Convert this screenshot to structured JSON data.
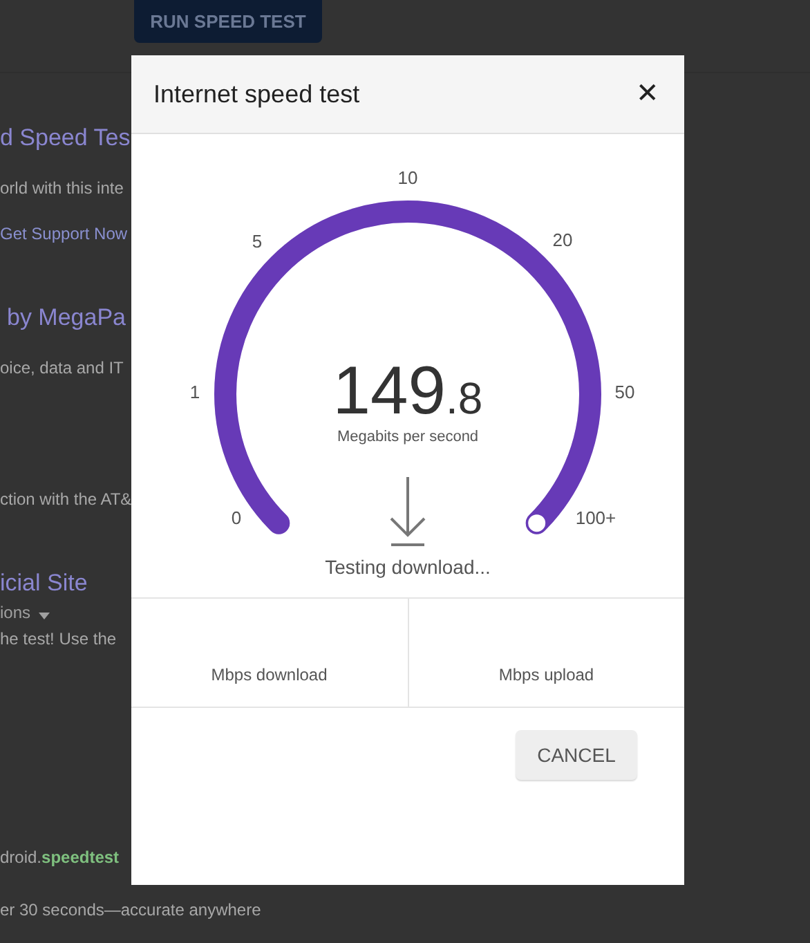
{
  "background_page": {
    "run_button": "RUN SPEED TEST",
    "results": [
      {
        "kind": "title",
        "text": "d Speed Tes"
      },
      {
        "kind": "text",
        "text": "orld with this inte"
      },
      {
        "kind": "link",
        "text": "Get Support Now"
      },
      {
        "kind": "title",
        "text": "by MegaPa"
      },
      {
        "kind": "text",
        "text": "oice, data and IT"
      },
      {
        "kind": "text",
        "text": "ction with the AT&"
      },
      {
        "kind": "title",
        "text": "icial Site"
      },
      {
        "kind": "meta",
        "text": "ions"
      },
      {
        "kind": "text",
        "text": "he test! Use the"
      },
      {
        "kind": "url",
        "text": "droid.**speedtest**"
      },
      {
        "kind": "text",
        "text": "er 30 seconds—accurate anywhere"
      }
    ]
  },
  "dialog": {
    "title": "Internet speed test",
    "close": "✕",
    "gauge": {
      "level": 1,
      "ticks": [
        "0",
        "1",
        "5",
        "10",
        "20",
        "50",
        "100+"
      ],
      "value_whole": "149",
      "value_fraction": ".8",
      "unit": "Megabits per second",
      "status": "Testing download..."
    },
    "stats": [
      {
        "label": "Mbps download"
      },
      {
        "label": "Mbps upload"
      }
    ],
    "buttons": [
      "CANCEL"
    ]
  }
}
